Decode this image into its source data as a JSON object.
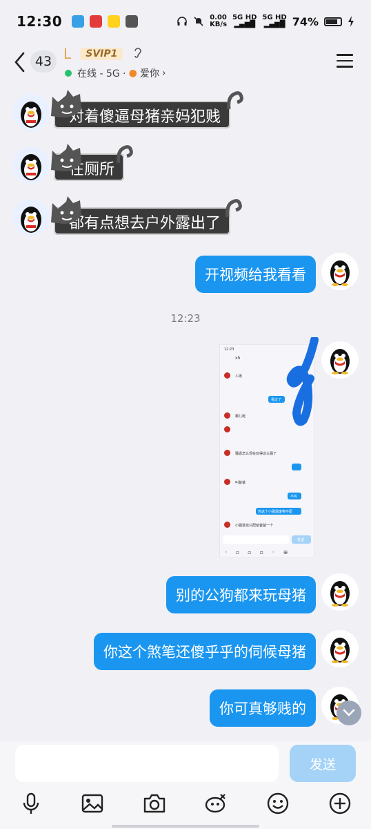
{
  "status_bar": {
    "time": "12:30",
    "speed": "0.00",
    "speed_unit": "KB/s",
    "net1": "5G HD",
    "net2": "5G HD",
    "battery": "74%"
  },
  "header": {
    "unread_count": "43",
    "contact_name": "L",
    "vip_badge": "SVIP1",
    "status_text": "在线 - 5G ·",
    "status_extra": "爱你",
    "chevron": "›"
  },
  "messages": [
    {
      "side": "left",
      "text": "对着傻逼母猪亲妈犯贱"
    },
    {
      "side": "left",
      "text": "在厕所"
    },
    {
      "side": "left",
      "text": "都有点想去户外露出了"
    },
    {
      "side": "right",
      "text": "开视频给我看看"
    },
    {
      "type": "timestamp",
      "text": "12:23"
    },
    {
      "side": "right",
      "type": "image"
    },
    {
      "side": "right",
      "text": "别的公狗都来玩母猪"
    },
    {
      "side": "right",
      "text": "你这个煞笔还傻乎乎的伺候母猪"
    },
    {
      "side": "right",
      "text": "你可真够贱的"
    }
  ],
  "shot": {
    "top_time": "12:23",
    "title": "xh",
    "lines": [
      "人呢",
      "看过了",
      "哪儿呢",
      "骚逼怎么现在玩得这么骚了",
      "叫爸爸",
      "不叫",
      "你这个小骚逼废物不配",
      "小骚逼也只配给爸爸一个"
    ],
    "send": "发送"
  },
  "composer": {
    "placeholder": "",
    "send_label": "发送"
  },
  "toolbar": [
    "mic-icon",
    "image-icon",
    "camera-icon",
    "red-packet-icon",
    "emoji-icon",
    "plus-icon"
  ],
  "colors": {
    "bubble_right": "#1a96f0",
    "bubble_left": "#3a3a3a",
    "background": "#f0f0f5",
    "vip": "#e3a64f"
  }
}
